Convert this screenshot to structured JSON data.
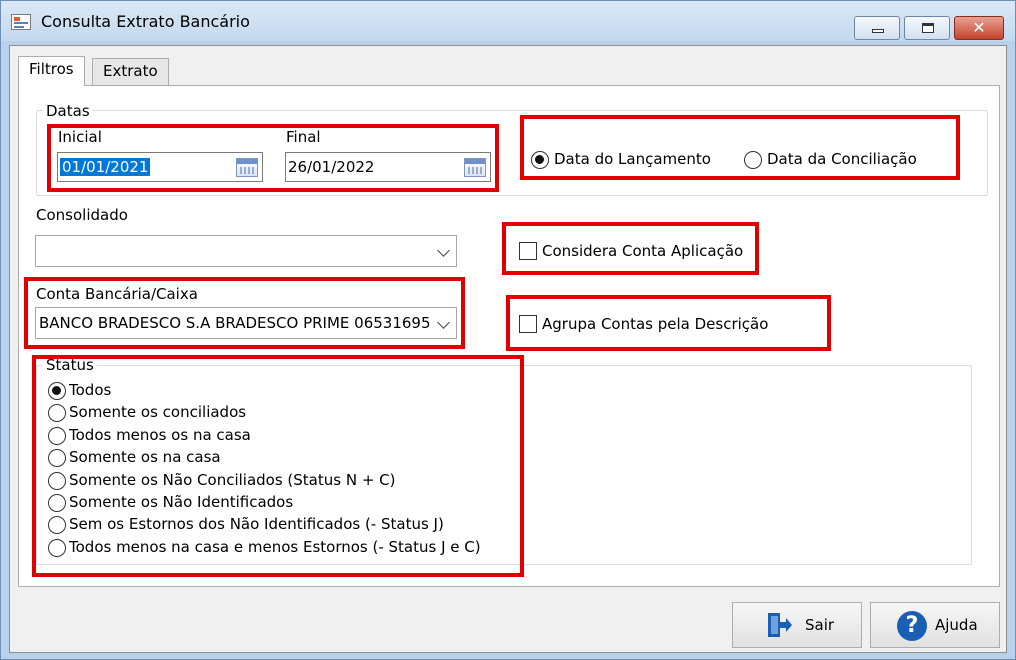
{
  "window": {
    "title": "Consulta Extrato Bancário"
  },
  "tabs": [
    {
      "label": "Filtros"
    },
    {
      "label": "Extrato"
    }
  ],
  "datas": {
    "group_label": "Datas",
    "inicial_label": "Inicial",
    "inicial_value": "01/01/2021",
    "final_label": "Final",
    "final_value": "26/01/2022",
    "radio_lancamento": "Data do Lançamento",
    "radio_conciliacao": "Data da Conciliação"
  },
  "consolidado": {
    "label": "Consolidado",
    "value": ""
  },
  "conta": {
    "label": "Conta Bancária/Caixa",
    "value": "BANCO BRADESCO S.A BRADESCO PRIME 06531695"
  },
  "checks": {
    "considera": "Considera Conta Aplicação",
    "agrupa": "Agrupa Contas pela Descrição"
  },
  "status": {
    "group_label": "Status",
    "options": [
      "Todos",
      "Somente os conciliados",
      "Todos menos os na casa",
      "Somente os na casa",
      "Somente os Não Conciliados (Status N + C)",
      "Somente os Não Identificados",
      "Sem os Estornos dos Não Identificados (- Status J)",
      "Todos menos na casa e menos Estornos (- Status J e C)"
    ]
  },
  "buttons": {
    "sair": "Sair",
    "ajuda": "Ajuda"
  },
  "colors": {
    "highlight": "#e00000",
    "selection": "#0078d7"
  }
}
